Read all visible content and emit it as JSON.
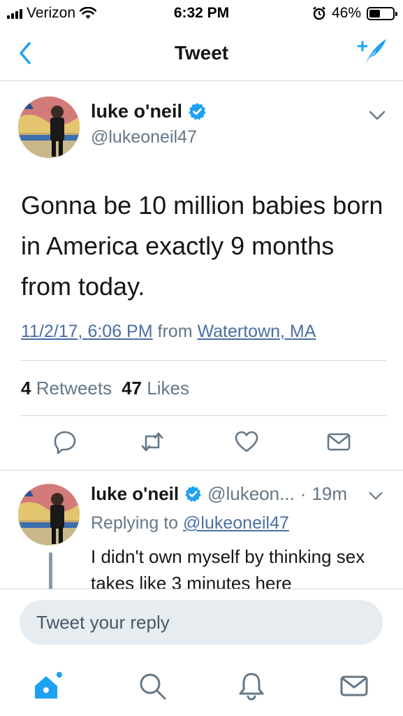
{
  "status_bar": {
    "carrier": "Verizon",
    "time": "6:32 PM",
    "battery": "46%",
    "battery_level": 0.46,
    "icons": [
      "signal-icon",
      "wifi-icon",
      "alarm-icon",
      "battery-icon"
    ]
  },
  "nav": {
    "title": "Tweet",
    "back_icon": "back-chevron-icon",
    "compose_icon": "compose-tweet-icon"
  },
  "tweet": {
    "author_name": "luke o'neil",
    "handle": "@lukeoneil47",
    "verified": true,
    "text": "Gonna be 10 million babies born in America exactly 9 months from today.",
    "timestamp": "11/2/17, 6:06 PM",
    "from_label": "from",
    "location": "Watertown, MA",
    "retweets_count": "4",
    "retweets_label": "Retweets",
    "likes_count": "47",
    "likes_label": "Likes",
    "actions": [
      "reply-icon",
      "retweet-icon",
      "like-icon",
      "share-icon"
    ]
  },
  "reply": {
    "author_name": "luke o'neil",
    "handle": "@lukeon...",
    "separator": "·",
    "age": "19m",
    "replying_prefix": "Replying to",
    "replying_to": "@lukeoneil47",
    "text": "I didn't own myself by thinking sex takes like 3 minutes here"
  },
  "composer": {
    "placeholder": "Tweet your reply"
  },
  "tab_bar": {
    "tabs": [
      "home-icon",
      "search-icon",
      "notifications-icon",
      "messages-icon"
    ]
  },
  "colors": {
    "accent": "#1da1f2",
    "link": "#4a6fa5",
    "secondary_text": "#657786",
    "verified": "#1da1f2"
  }
}
